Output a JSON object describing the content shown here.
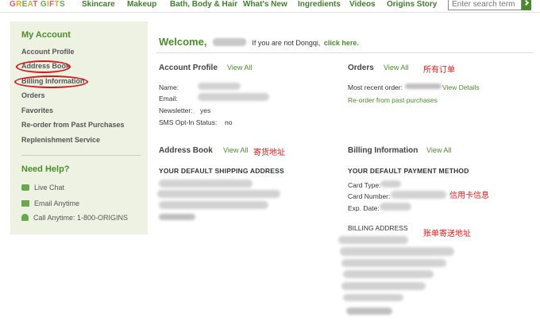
{
  "nav": {
    "logo": "GREAT GIFTS",
    "items": [
      "Skincare",
      "Makeup",
      "Bath, Body & Hair",
      "What's New",
      "Ingredients",
      "Videos",
      "Origins Story"
    ],
    "search_placeholder": "Enter search term"
  },
  "sidebar": {
    "heading": "My Account",
    "links": [
      "Account Profile",
      "Address Book",
      "Billing Information",
      "Orders",
      "Favorites",
      "Re-order from Past Purchases",
      "Replenishment Service"
    ],
    "help_heading": "Need Help?",
    "help": [
      "Live Chat",
      "Email Anytime",
      "Call Anytime: 1-800-ORIGINS"
    ]
  },
  "welcome": {
    "prefix": "Welcome,",
    "middle": "If you are not Dongqi,",
    "link": "click here."
  },
  "profile": {
    "title": "Account Profile",
    "view_all": "View All",
    "name_label": "Name:",
    "email_label": "Email:",
    "newsletter_label": "Newsletter:",
    "newsletter_value": "yes",
    "sms_label": "SMS Opt-In Status:",
    "sms_value": "no"
  },
  "orders": {
    "title": "Orders",
    "view_all": "View All",
    "annotation": "所有订单",
    "recent_label": "Most recent order:",
    "view_details": "View Details",
    "reorder": "Re-order from past purchases"
  },
  "address": {
    "title": "Address Book",
    "view_all": "View All",
    "annotation": "寄货地址",
    "default_label": "YOUR DEFAULT SHIPPING ADDRESS"
  },
  "billing": {
    "title": "Billing Information",
    "view_all": "View All",
    "default_label": "YOUR DEFAULT PAYMENT METHOD",
    "card_type_label": "Card Type:",
    "card_number_label": "Card Number:",
    "card_annotation": "信用卡信息",
    "exp_label": "Exp. Date:",
    "billing_address_label": "BILLING ADDRESS",
    "billing_annotation": "账单寄送地址"
  },
  "colors": {
    "brand_green": "#4c8c2b",
    "sidebar_bg": "#eef2e3",
    "annotation_red": "#e0191c"
  }
}
